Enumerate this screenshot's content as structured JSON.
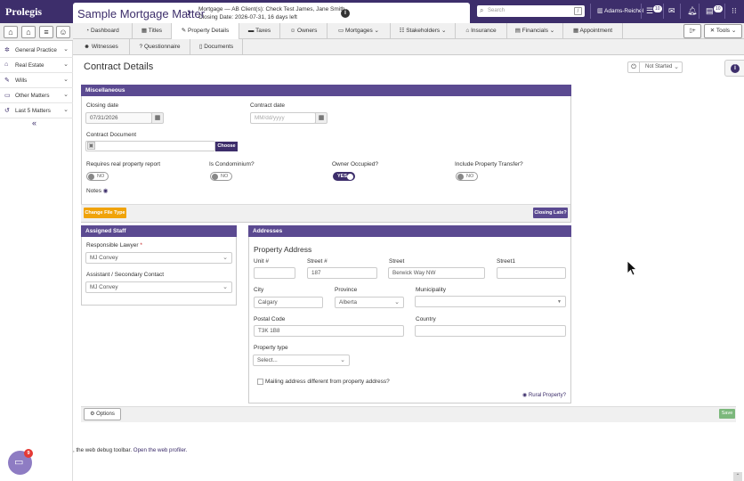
{
  "header": {
    "logo": "Prolegis",
    "matter_title": "Sample Mortgage Matter",
    "matter_line1": "Mortgage — AB Client(s): Check Test James, Jane Smith",
    "matter_line2": "Closing Date: 2026-07-31, 16 days left",
    "search_placeholder": "Search",
    "user": "Adams-Reichel",
    "badge_tasks": "10",
    "badge_docs": "10"
  },
  "sidebar": {
    "items": [
      {
        "label": "General Practice"
      },
      {
        "label": "Real Estate"
      },
      {
        "label": "Wills"
      },
      {
        "label": "Other Matters"
      },
      {
        "label": "Last 5 Matters"
      }
    ],
    "collapse": "«"
  },
  "tabs_row1": [
    "Dashboard",
    "Titles",
    "Property Details",
    "Taxes",
    "Owners",
    "Mortgages",
    "Stakeholders",
    "Insurance",
    "Financials",
    "Appointment"
  ],
  "tabs_row2": [
    "Witnesses",
    "Questionnaire",
    "Documents"
  ],
  "tools_label": "Tools",
  "page": {
    "title": "Contract Details",
    "status": "Not Started"
  },
  "misc": {
    "heading": "Miscellaneous",
    "closing_date_label": "Closing date",
    "closing_date_value": "07/31/2026",
    "contract_date_label": "Contract date",
    "contract_date_placeholder": "MM/dd/yyyy",
    "contract_doc_label": "Contract Document",
    "choose_label": "Choose",
    "q1_label": "Requires real property report",
    "q1_value": "NO",
    "q2_label": "Is Condominium?",
    "q2_value": "NO",
    "q3_label": "Owner Occupied?",
    "q3_value": "YES",
    "q4_label": "Include Property Transfer?",
    "q4_value": "NO",
    "notes_label": "Notes",
    "change_file_type": "Change File Type",
    "closing_late": "Closing Late?"
  },
  "staff": {
    "heading": "Assigned Staff",
    "lawyer_label": "Responsible Lawyer",
    "required_mark": "*",
    "lawyer_value": "MJ Convey",
    "assistant_label": "Assistant / Secondary Contact",
    "assistant_value": "MJ Convey"
  },
  "addresses": {
    "heading": "Addresses",
    "subheading": "Property Address",
    "unit_label": "Unit #",
    "unit_value": "",
    "street_no_label": "Street #",
    "street_no_value": "187",
    "street_label": "Street",
    "street_value": "Berwick Way NW",
    "street1_label": "Street1",
    "street1_value": "",
    "city_label": "City",
    "city_value": "Calgary",
    "province_label": "Province",
    "province_value": "Alberta",
    "municipality_label": "Municipality",
    "municipality_value": "",
    "postal_label": "Postal Code",
    "postal_value": "T3K 1B8",
    "country_label": "Country",
    "country_value": "",
    "property_type_label": "Property type",
    "property_type_value": "Select...",
    "mailing_label": "Mailing address different from property address?",
    "rural_label": "Rural Property?"
  },
  "footer": {
    "options": "Options",
    "save": "Save",
    "debug_text": ", the web debug toolbar.",
    "debug_link": "Open the web profiler.",
    "chat_badge": "9"
  }
}
